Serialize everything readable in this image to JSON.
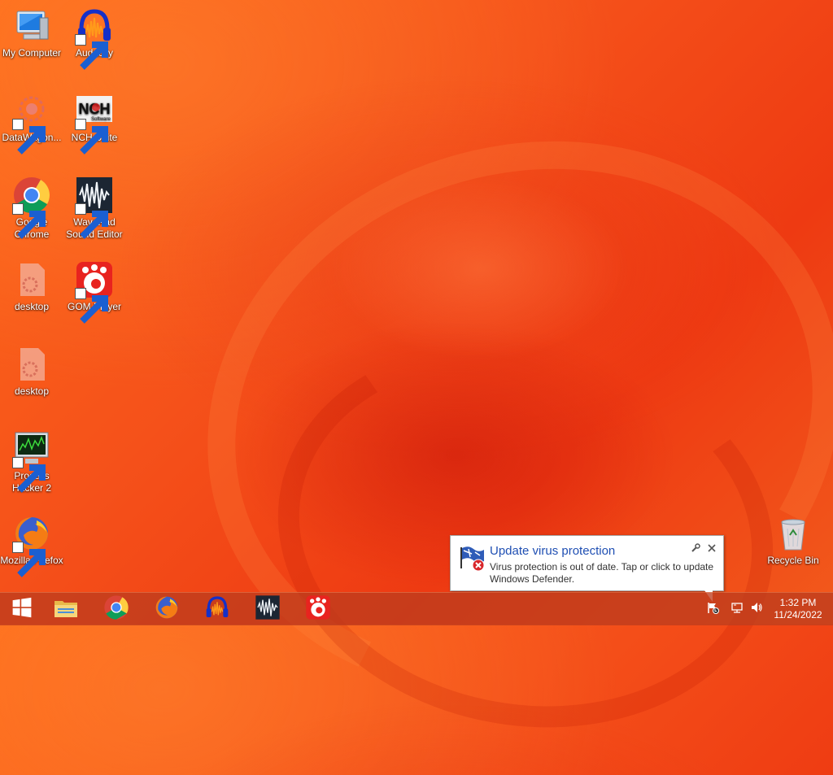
{
  "desktop": {
    "icons": [
      {
        "name": "my-computer",
        "label": "My Computer",
        "icon": "computer-icon"
      },
      {
        "name": "audacity",
        "label": "Audacity",
        "icon": "audacity-icon"
      },
      {
        "name": "datawagon",
        "label": "DataWagon...",
        "icon": "datawagon-icon"
      },
      {
        "name": "nch-suite",
        "label": "NCH Suite",
        "icon": "nch-icon",
        "logo_text": "NCH",
        "logo_sub": "Software"
      },
      {
        "name": "google-chrome",
        "label": "Google Chrome",
        "icon": "chrome-icon"
      },
      {
        "name": "wavepad",
        "label": "WavePad Sound Editor",
        "icon": "wavepad-icon"
      },
      {
        "name": "desktop-1",
        "label": "desktop",
        "icon": "config-file-icon"
      },
      {
        "name": "gom-player",
        "label": "GOM Player",
        "icon": "gom-icon"
      },
      {
        "name": "desktop-2",
        "label": "desktop",
        "icon": "config-file-icon"
      },
      {
        "name": "process-hacker",
        "label": "Process Hacker 2",
        "icon": "process-hacker-icon"
      },
      {
        "name": "mozilla-firefox",
        "label": "Mozilla Firefox",
        "icon": "firefox-icon"
      },
      {
        "name": "recycle-bin",
        "label": "Recycle Bin",
        "icon": "recycle-bin-icon"
      }
    ]
  },
  "taskbar": {
    "start": {
      "icon": "windows-logo-icon"
    },
    "pinned": [
      {
        "name": "file-explorer",
        "icon": "folder-icon"
      },
      {
        "name": "chrome",
        "icon": "chrome-icon"
      },
      {
        "name": "firefox",
        "icon": "firefox-icon"
      },
      {
        "name": "audacity",
        "icon": "audacity-icon"
      },
      {
        "name": "wavepad",
        "icon": "wavepad-icon"
      },
      {
        "name": "gom-player",
        "icon": "gom-icon"
      }
    ],
    "tray": {
      "icons": [
        "action-center-flag-icon",
        "network-icon",
        "volume-icon"
      ],
      "time": "1:32 PM",
      "date": "11/24/2022"
    }
  },
  "notification": {
    "title": "Update virus protection",
    "message": "Virus protection is out of date. Tap or click to update Windows Defender.",
    "icon": "defender-flag-error-icon",
    "tools": [
      "settings-wrench-icon",
      "close-icon"
    ]
  },
  "colors": {
    "wallpaper": "#f5511a",
    "title_blue": "#1f4fb3",
    "taskbar": "#be3c1e"
  }
}
